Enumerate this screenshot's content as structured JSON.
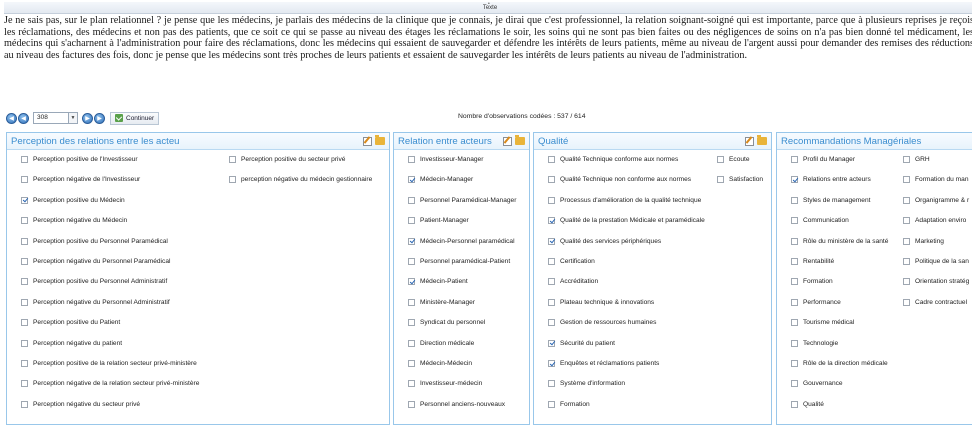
{
  "text_section": {
    "title": "Texte",
    "paragraph": "Je ne sais pas, sur le plan relationnel ? je pense que les médecins, je parlais des médecins de la clinique que je connais, je dirai que c'est professionnel, la relation soignant-soigné qui est importante, parce que à plusieurs reprises je reçois les réclamations, des médecins et non pas des patients, que ce soit ce qui se passe au niveau des étages les réclamations le soir, les soins qui ne sont pas bien faites ou des négligences de soins on n'a pas bien donné tel médicament, les médecins qui s'acharnent à l'administration pour faire des réclamations, donc les médecins qui essaient de sauvegarder et défendre les intérêts de leurs patients, même au niveau de l'argent aussi pour demander des remises des réductions au niveau des factures des fois, donc je pense que les médecins sont très proches de leurs patients et essaient de sauvegarder les intérêts de leurs patients au niveau de l'administration."
  },
  "toolbar": {
    "page_value": "308",
    "continue_label": "Continuer",
    "observations_label": "Nombre d'observations codées : 537 / 614"
  },
  "panels": [
    {
      "title": "Perception des relations entre les acteu",
      "columns": [
        [
          {
            "label": "Perception positive de l'Investisseur",
            "checked": false
          },
          {
            "label": "Perception négative de l'Investisseur",
            "checked": false
          },
          {
            "label": "Perception positive du Médecin",
            "checked": true
          },
          {
            "label": "Perception négative du Médecin",
            "checked": false
          },
          {
            "label": "Perception positive du Personnel Paramédical",
            "checked": false
          },
          {
            "label": "Perception négative du Personnel Paramédical",
            "checked": false
          },
          {
            "label": "Perception positive du Personnel Administratif",
            "checked": false
          },
          {
            "label": "Perception négative du Personnel Administratif",
            "checked": false
          },
          {
            "label": "Perception positive du Patient",
            "checked": false
          },
          {
            "label": "Perception négative du patient",
            "checked": false
          },
          {
            "label": "Perception positive de la relation secteur privé-ministère",
            "checked": false
          },
          {
            "label": "Perception négative de la relation secteur privé-ministère",
            "checked": false
          },
          {
            "label": "Perception négative du secteur privé",
            "checked": false
          }
        ],
        [
          {
            "label": "Perception positive du secteur privé",
            "checked": false
          },
          {
            "label": "perception négative du médecin gestionnaire",
            "checked": false
          }
        ]
      ]
    },
    {
      "title": "Relation entre acteurs",
      "columns": [
        [
          {
            "label": "Investisseur-Manager",
            "checked": false
          },
          {
            "label": "Médecin-Manager",
            "checked": true
          },
          {
            "label": "Personnel Paramédical-Manager",
            "checked": false
          },
          {
            "label": "Patient-Manager",
            "checked": false
          },
          {
            "label": "Médecin-Personnel paramédical",
            "checked": true
          },
          {
            "label": "Personnel paramédical-Patient",
            "checked": false
          },
          {
            "label": "Médecin-Patient",
            "checked": true
          },
          {
            "label": "Ministère-Manager",
            "checked": false
          },
          {
            "label": "Syndicat du personnel",
            "checked": false
          },
          {
            "label": "Direction médicale",
            "checked": false
          },
          {
            "label": "Médecin-Médecin",
            "checked": false
          },
          {
            "label": "Investisseur-médecin",
            "checked": false
          },
          {
            "label": "Personnel anciens-nouveaux",
            "checked": false
          }
        ]
      ]
    },
    {
      "title": "Qualité",
      "columns": [
        [
          {
            "label": "Qualité Technique conforme aux normes",
            "checked": false
          },
          {
            "label": "Qualité Technique non conforme aux normes",
            "checked": false
          },
          {
            "label": "Processus d'amélioration de la qualité technique",
            "checked": false
          },
          {
            "label": "Qualité de la prestation Médicale et paramédicale",
            "checked": true
          },
          {
            "label": "Qualité des services périphériques",
            "checked": true
          },
          {
            "label": "Certification",
            "checked": false
          },
          {
            "label": "Accréditation",
            "checked": false
          },
          {
            "label": "Plateau technique & innovations",
            "checked": false
          },
          {
            "label": "Gestion de ressources humaines",
            "checked": false
          },
          {
            "label": "Sécurité du patient",
            "checked": true
          },
          {
            "label": "Enquêtes et réclamations patients",
            "checked": true
          },
          {
            "label": "Système d'information",
            "checked": false
          },
          {
            "label": "Formation",
            "checked": false
          }
        ],
        [
          {
            "label": "Ecoute",
            "checked": false
          },
          {
            "label": "Satisfaction",
            "checked": false
          }
        ]
      ]
    },
    {
      "title": "Recommandations Managériales",
      "columns": [
        [
          {
            "label": "Profil du Manager",
            "checked": false
          },
          {
            "label": "Relations entre acteurs",
            "checked": true
          },
          {
            "label": "Styles de management",
            "checked": false
          },
          {
            "label": "Communication",
            "checked": false
          },
          {
            "label": "Rôle du ministère de la santé",
            "checked": false
          },
          {
            "label": "Rentabilité",
            "checked": false
          },
          {
            "label": "Formation",
            "checked": false
          },
          {
            "label": "Performance",
            "checked": false
          },
          {
            "label": "Tourisme médical",
            "checked": false
          },
          {
            "label": "Technologie",
            "checked": false
          },
          {
            "label": "Rôle de la direction médicale",
            "checked": false
          },
          {
            "label": "Gouvernance",
            "checked": false
          },
          {
            "label": "Qualité",
            "checked": false
          }
        ],
        [
          {
            "label": "GRH",
            "checked": false
          },
          {
            "label": "Formation du man",
            "checked": false
          },
          {
            "label": "Organigramme & r",
            "checked": false
          },
          {
            "label": "Adaptation enviro",
            "checked": false
          },
          {
            "label": "Marketing",
            "checked": false
          },
          {
            "label": "Politique de la san",
            "checked": false
          },
          {
            "label": "Orientation stratég",
            "checked": false
          },
          {
            "label": "Cadre contractuel",
            "checked": false
          }
        ]
      ]
    }
  ]
}
